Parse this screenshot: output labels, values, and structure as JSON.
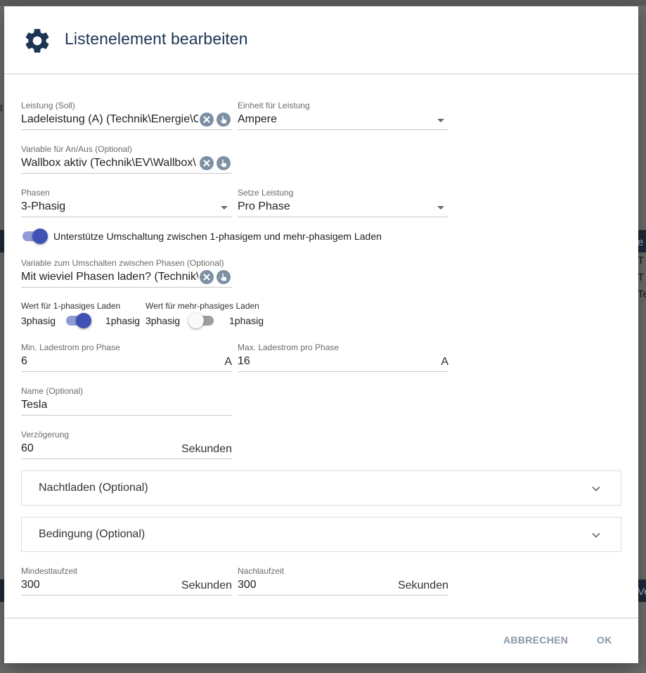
{
  "background": {
    "left_text": "t",
    "right_texts": [
      "e",
      "T",
      "T",
      "Te",
      "Ve"
    ]
  },
  "dialog": {
    "title": "Listenelement bearbeiten",
    "icon": "gear-icon"
  },
  "fields": {
    "leistung": {
      "label": "Leistung (Soll)",
      "value": "Ladeleistung (A) (Technik\\Energie\\C"
    },
    "einheit": {
      "label": "Einheit für Leistung",
      "value": "Ampere"
    },
    "variable_anaus": {
      "label": "Variable für An/Aus (Optional)",
      "value": "Wallbox aktiv (Technik\\EV\\Wallbox\\"
    },
    "phasen": {
      "label": "Phasen",
      "value": "3-Phasig"
    },
    "setze_leistung": {
      "label": "Setze Leistung",
      "value": "Pro Phase"
    },
    "umschaltung_toggle": {
      "label": "Unterstütze Umschaltung zwischen 1-phasigem und mehr-phasigem Laden",
      "on": true
    },
    "variable_umschalten": {
      "label": "Variable zum Umschalten zwischen Phasen (Optional)",
      "value": "Mit wieviel Phasen laden? (Technik\\"
    },
    "wert_1phasig": {
      "label": "Wert für 1-phasiges Laden",
      "left": "3phasig",
      "right": "1phasig",
      "on": true
    },
    "wert_mehrphasig": {
      "label": "Wert für mehr-phasiges Laden",
      "left": "3phasig",
      "right": "1phasig",
      "on": false
    },
    "min_ladestrom": {
      "label": "Min. Ladestrom pro Phase",
      "value": "6",
      "suffix": "A"
    },
    "max_ladestrom": {
      "label": "Max. Ladestrom pro Phase",
      "value": "16",
      "suffix": "A"
    },
    "name": {
      "label": "Name (Optional)",
      "value": "Tesla"
    },
    "verzoegerung": {
      "label": "Verzögerung",
      "value": "60",
      "suffix": "Sekunden"
    },
    "mindestlaufzeit": {
      "label": "Mindestlaufzeit",
      "value": "300",
      "suffix": "Sekunden"
    },
    "nachlaufzeit": {
      "label": "Nachlaufzeit",
      "value": "300",
      "suffix": "Sekunden"
    }
  },
  "panels": {
    "nachtladen": "Nachtladen (Optional)",
    "bedingung": "Bedingung (Optional)"
  },
  "buttons": {
    "cancel": "ABBRECHEN",
    "ok": "OK"
  },
  "colors": {
    "title": "#1c3554",
    "toggle_accent": "#3f51b5",
    "button_text": "#8797a8",
    "icon_button": "#7c8fa3"
  }
}
